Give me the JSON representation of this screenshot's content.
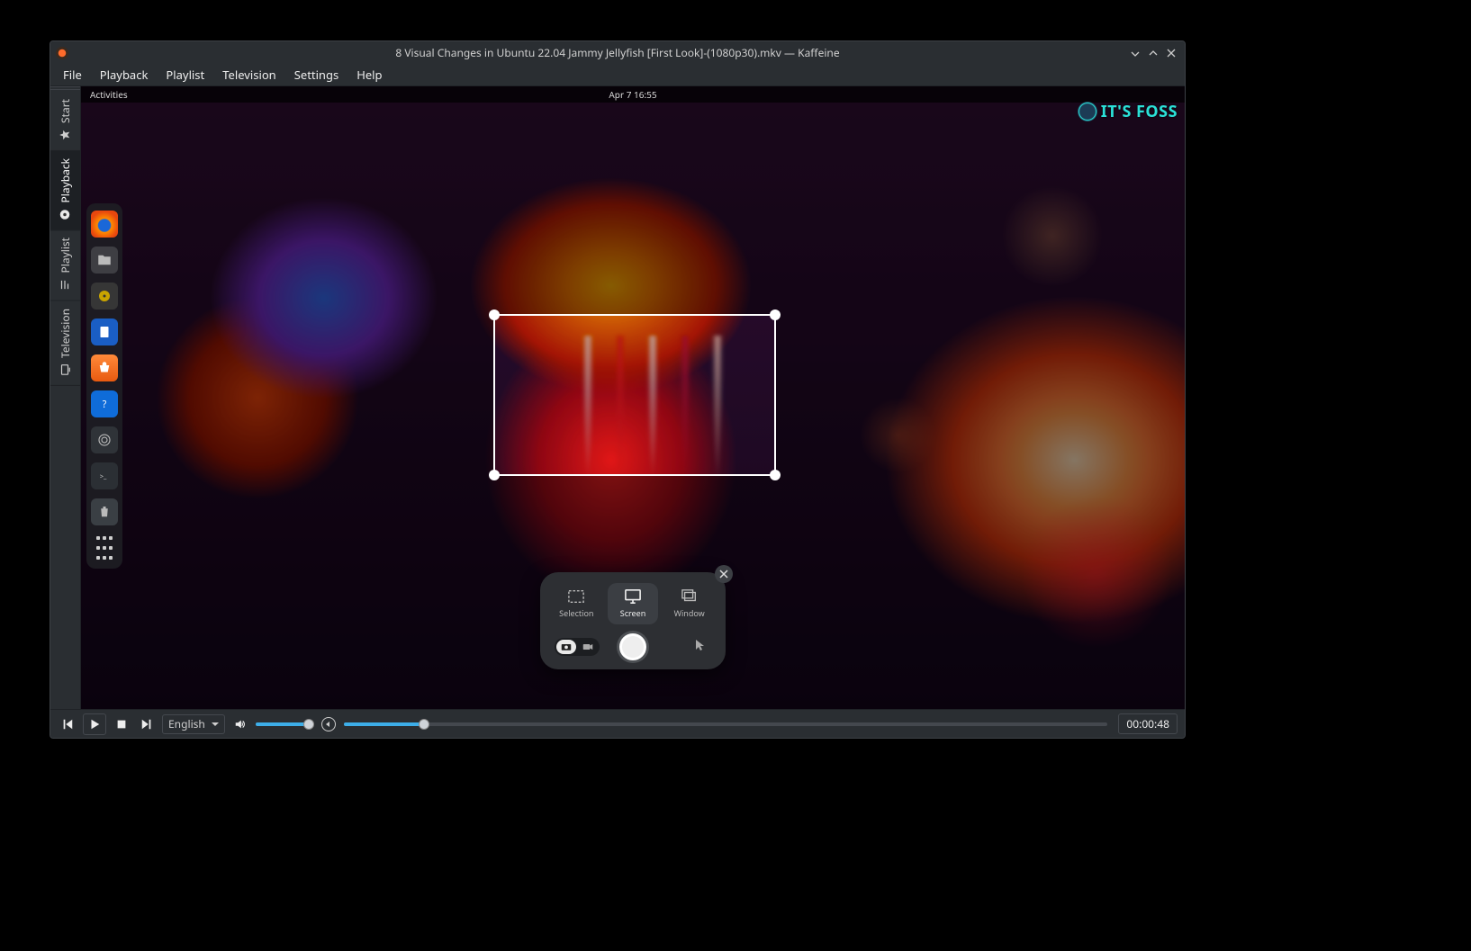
{
  "titlebar": {
    "title": "8 Visual Changes in Ubuntu 22.04 Jammy Jellyfish [First Look]-(1080p30).mkv — Kaffeine"
  },
  "menubar": [
    "File",
    "Playback",
    "Playlist",
    "Television",
    "Settings",
    "Help"
  ],
  "side_tabs": [
    {
      "label": "Start",
      "icon": "star-icon"
    },
    {
      "label": "Playback",
      "icon": "disc-icon",
      "active": true
    },
    {
      "label": "Playlist",
      "icon": "list-icon"
    },
    {
      "label": "Television",
      "icon": "tv-icon"
    }
  ],
  "gnome": {
    "activities": "Activities",
    "clock": "Apr 7  16:55"
  },
  "watermark": "IT'S FOSS",
  "dock": [
    "firefox",
    "files",
    "music",
    "docs",
    "software",
    "help",
    "obs",
    "term",
    "trash",
    "apps"
  ],
  "screenshot_panel": {
    "modes": [
      {
        "label": "Selection",
        "active": false
      },
      {
        "label": "Screen",
        "active": true
      },
      {
        "label": "Window",
        "active": false
      }
    ],
    "photo_active": true
  },
  "player": {
    "subtitle_lang": "English",
    "time": "00:00:48"
  }
}
